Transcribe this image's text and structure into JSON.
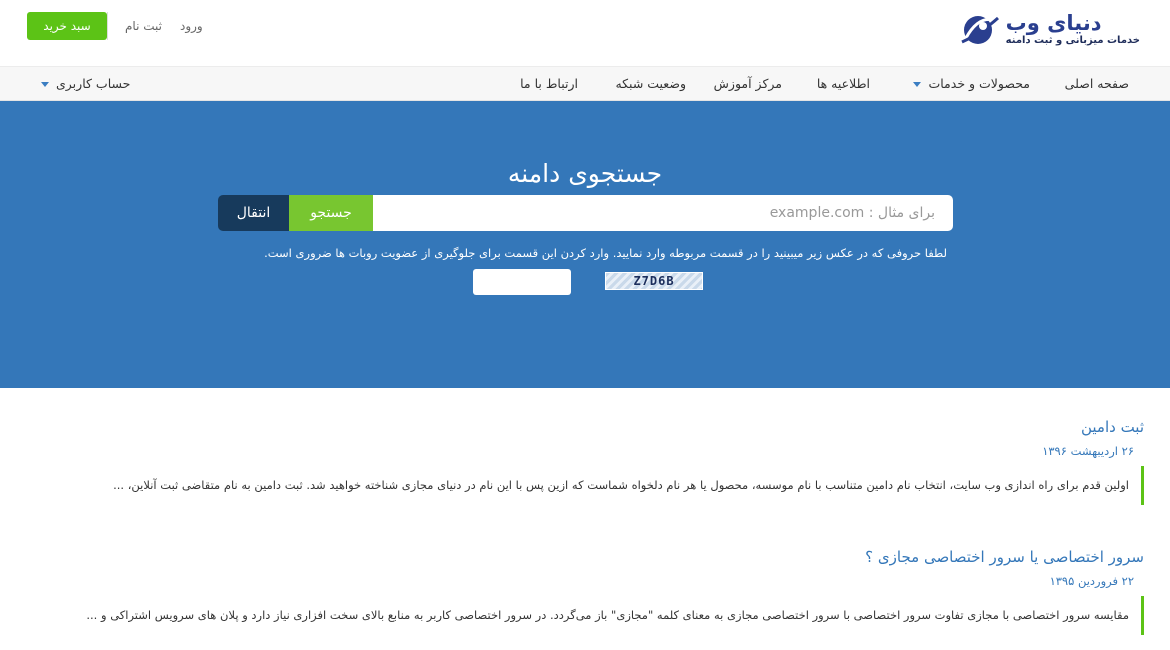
{
  "header": {
    "logo_title": "دنیای وب",
    "logo_subtitle": "خدمات میزبانی و ثبت دامنه",
    "cart_label": "سبد خرید",
    "register_label": "ثبت نام",
    "login_label": "ورود"
  },
  "nav": {
    "items": [
      "صفحه اصلی",
      "محصولات و خدمات",
      "اطلاعیه ها",
      "مرکز آموزش",
      "وضعیت شبکه",
      "ارتباط با ما"
    ],
    "account_label": "حساب کاربری"
  },
  "hero": {
    "title": "جستجوی دامنه",
    "search_placeholder": "برای مثال : example.com",
    "search_label": "جستجو",
    "transfer_label": "انتقال",
    "captcha_instructions": "لطفا حروفی که در عکس زیر میبینید را در قسمت مربوطه وارد نمایید. وارد کردن این قسمت برای جلوگیری از عضویت روبات ها ضروری است.",
    "captcha_code": "Z7D6B"
  },
  "articles": [
    {
      "title": "ثبت دامین",
      "date": "۲۶ اردیبهشت ۱۳۹۶",
      "excerpt": "اولین قدم برای راه اندازی وب سایت، انتخاب نام دامین متناسب با نام موسسه، محصول یا هر نام دلخواه شماست که ازین پس با این نام در دنیای مجازی شناخته خواهید شد. ثبت دامین به نام متقاضی ثبت آنلاین، ..."
    },
    {
      "title": "سرور اختصاصی یا سرور اختصاصی مجازی ؟",
      "date": "۲۲ فروردین ۱۳۹۵",
      "excerpt": "مقایسه سرور اختصاصی با مجازی تفاوت سرور اختصاصی با سرور اختصاصی مجازی به معنای کلمه \"مجازی\" باز می‌گردد. در سرور اختصاصی کاربر به منابع بالای سخت افزاری نیاز دارد و پلان های سرویس اشتراکی و ..."
    }
  ],
  "colors": {
    "hero_blue": "#3477b9",
    "accent_green": "#5cc316",
    "transfer_dark": "#173a5c"
  }
}
